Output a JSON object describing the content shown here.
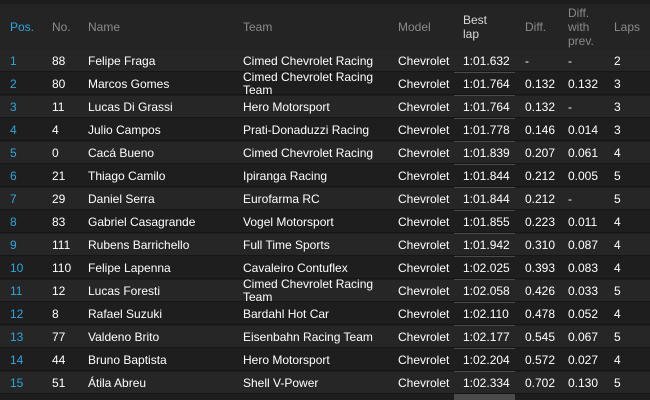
{
  "headers": {
    "pos": "Pos.",
    "no": "No.",
    "name": "Name",
    "team": "Team",
    "model": "Model",
    "best": "Best\nlap",
    "diff": "Diff.",
    "prev": "Diff.\nwith\nprev.",
    "laps": "Laps"
  },
  "rows": [
    {
      "pos": "1",
      "no": "88",
      "name": "Felipe Fraga",
      "team": "Cimed Chevrolet Racing",
      "model": "Chevrolet",
      "best": "1:01.632",
      "diff": "-",
      "prev": "-",
      "laps": "2"
    },
    {
      "pos": "2",
      "no": "80",
      "name": "Marcos Gomes",
      "team": "Cimed Chevrolet Racing\nTeam",
      "model": "Chevrolet",
      "best": "1:01.764",
      "diff": "0.132",
      "prev": "0.132",
      "laps": "3"
    },
    {
      "pos": "3",
      "no": "11",
      "name": "Lucas Di Grassi",
      "team": "Hero Motorsport",
      "model": "Chevrolet",
      "best": "1:01.764",
      "diff": "0.132",
      "prev": "-",
      "laps": "3"
    },
    {
      "pos": "4",
      "no": "4",
      "name": "Julio Campos",
      "team": "Prati-Donaduzzi Racing",
      "model": "Chevrolet",
      "best": "1:01.778",
      "diff": "0.146",
      "prev": "0.014",
      "laps": "3"
    },
    {
      "pos": "5",
      "no": "0",
      "name": "Cacá Bueno",
      "team": "Cimed Chevrolet Racing",
      "model": "Chevrolet",
      "best": "1:01.839",
      "diff": "0.207",
      "prev": "0.061",
      "laps": "4"
    },
    {
      "pos": "6",
      "no": "21",
      "name": "Thiago Camilo",
      "team": "Ipiranga Racing",
      "model": "Chevrolet",
      "best": "1:01.844",
      "diff": "0.212",
      "prev": "0.005",
      "laps": "5"
    },
    {
      "pos": "7",
      "no": "29",
      "name": "Daniel Serra",
      "team": "Eurofarma RC",
      "model": "Chevrolet",
      "best": "1:01.844",
      "diff": "0.212",
      "prev": "-",
      "laps": "5"
    },
    {
      "pos": "8",
      "no": "83",
      "name": "Gabriel Casagrande",
      "team": "Vogel Motorsport",
      "model": "Chevrolet",
      "best": "1:01.855",
      "diff": "0.223",
      "prev": "0.011",
      "laps": "4"
    },
    {
      "pos": "9",
      "no": "111",
      "name": "Rubens Barrichello",
      "team": "Full Time Sports",
      "model": "Chevrolet",
      "best": "1:01.942",
      "diff": "0.310",
      "prev": "0.087",
      "laps": "4"
    },
    {
      "pos": "10",
      "no": "110",
      "name": "Felipe Lapenna",
      "team": "Cavaleiro Contuflex",
      "model": "Chevrolet",
      "best": "1:02.025",
      "diff": "0.393",
      "prev": "0.083",
      "laps": "4"
    },
    {
      "pos": "11",
      "no": "12",
      "name": "Lucas Foresti",
      "team": "Cimed Chevrolet Racing\nTeam",
      "model": "Chevrolet",
      "best": "1:02.058",
      "diff": "0.426",
      "prev": "0.033",
      "laps": "5"
    },
    {
      "pos": "12",
      "no": "8",
      "name": "Rafael Suzuki",
      "team": "Bardahl Hot Car",
      "model": "Chevrolet",
      "best": "1:02.110",
      "diff": "0.478",
      "prev": "0.052",
      "laps": "4"
    },
    {
      "pos": "13",
      "no": "77",
      "name": "Valdeno Brito",
      "team": "Eisenbahn Racing Team",
      "model": "Chevrolet",
      "best": "1:02.177",
      "diff": "0.545",
      "prev": "0.067",
      "laps": "5"
    },
    {
      "pos": "14",
      "no": "44",
      "name": "Bruno Baptista",
      "team": "Hero Motorsport",
      "model": "Chevrolet",
      "best": "1:02.204",
      "diff": "0.572",
      "prev": "0.027",
      "laps": "4"
    },
    {
      "pos": "15",
      "no": "51",
      "name": "Átila Abreu",
      "team": "Shell V-Power",
      "model": "Chevrolet",
      "best": "1:02.334",
      "diff": "0.702",
      "prev": "0.130",
      "laps": "5"
    }
  ]
}
